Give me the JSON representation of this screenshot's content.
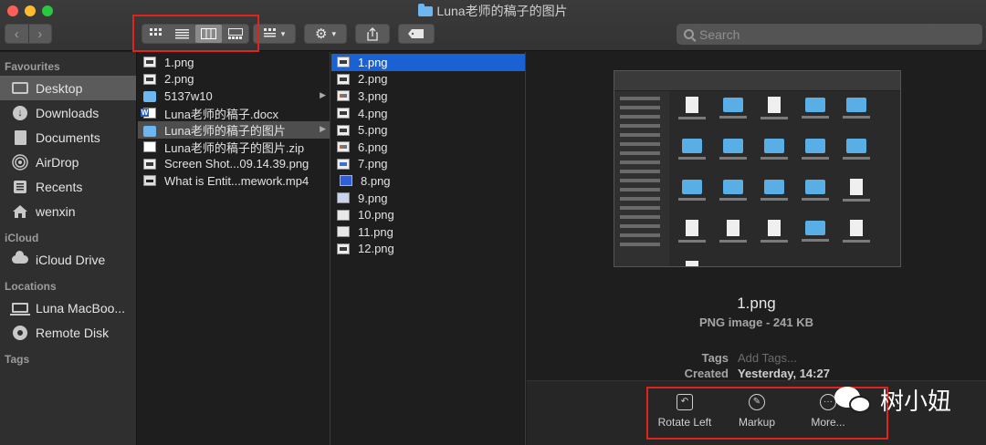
{
  "window": {
    "title": "Luna老师的稿子的图片"
  },
  "toolbar": {
    "back_icon": "chevron-left-icon",
    "forward_icon": "chevron-right-icon",
    "views": [
      "icon-view",
      "list-view",
      "column-view",
      "gallery-view"
    ],
    "active_view": "column-view",
    "search_placeholder": "Search"
  },
  "sidebar": {
    "favourites_header": "Favourites",
    "favourites": [
      {
        "label": "Desktop",
        "icon": "desktop-icon"
      },
      {
        "label": "Downloads",
        "icon": "downloads-icon"
      },
      {
        "label": "Documents",
        "icon": "documents-icon"
      },
      {
        "label": "AirDrop",
        "icon": "airdrop-icon"
      },
      {
        "label": "Recents",
        "icon": "recents-icon"
      },
      {
        "label": "wenxin",
        "icon": "home-icon"
      }
    ],
    "icloud_header": "iCloud",
    "icloud": [
      {
        "label": "iCloud Drive",
        "icon": "cloud-icon"
      }
    ],
    "locations_header": "Locations",
    "locations": [
      {
        "label": "Luna MacBoo...",
        "icon": "laptop-icon"
      },
      {
        "label": "Remote Disk",
        "icon": "disk-icon"
      }
    ],
    "tags_header": "Tags"
  },
  "column1": [
    {
      "label": "1.png",
      "kind": "image"
    },
    {
      "label": "2.png",
      "kind": "image"
    },
    {
      "label": "5137w10",
      "kind": "folder"
    },
    {
      "label": "Luna老师的稿子.docx",
      "kind": "word"
    },
    {
      "label": "Luna老师的稿子的图片",
      "kind": "folder"
    },
    {
      "label": "Luna老师的稿子的图片.zip",
      "kind": "zip"
    },
    {
      "label": "Screen Shot...09.14.39.png",
      "kind": "image"
    },
    {
      "label": "What is Entit...mework.mp4",
      "kind": "video"
    }
  ],
  "column2": [
    {
      "label": "1.png"
    },
    {
      "label": "2.png"
    },
    {
      "label": "3.png"
    },
    {
      "label": "4.png"
    },
    {
      "label": "5.png"
    },
    {
      "label": "6.png"
    },
    {
      "label": "7.png"
    },
    {
      "label": "8.png"
    },
    {
      "label": "9.png"
    },
    {
      "label": "10.png"
    },
    {
      "label": "11.png"
    },
    {
      "label": "12.png"
    }
  ],
  "preview": {
    "filename": "1.png",
    "kind": "PNG image - 241 KB",
    "tags_label": "Tags",
    "tags_placeholder": "Add Tags...",
    "created_label": "Created",
    "created_value": "Yesterday, 14:27",
    "actions": [
      {
        "label": "Rotate Left",
        "icon": "rotate-left-icon"
      },
      {
        "label": "Markup",
        "icon": "markup-icon"
      },
      {
        "label": "More...",
        "icon": "more-icon"
      }
    ]
  },
  "watermark": {
    "text": "树小妞"
  },
  "colors": {
    "accent": "#1a62d3",
    "highlight_box": "#e0241b",
    "folder": "#6db6ef"
  }
}
